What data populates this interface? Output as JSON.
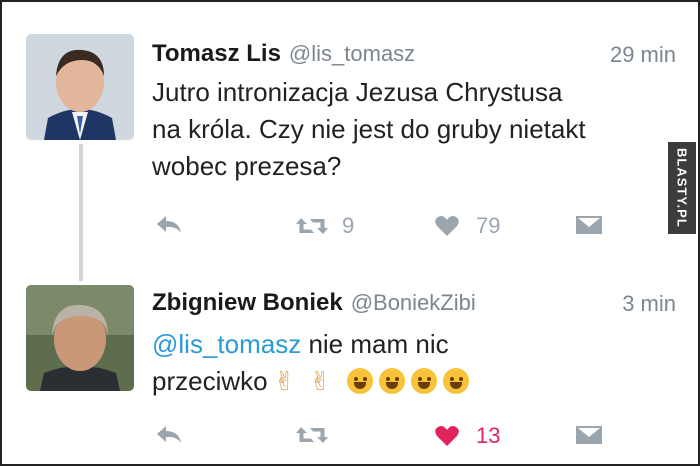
{
  "tweets": [
    {
      "author": "Tomasz Lis",
      "handle": "@lis_tomasz",
      "time": "29 min",
      "text_lines": [
        "Jutro intronizacja Jezusa Chrystusa",
        "na króla. Czy nie jest do gruby nietakt",
        "wobec prezesa?"
      ],
      "retweets": "9",
      "likes": "79",
      "avatar_icon": "man-portrait-suit"
    },
    {
      "author": "Zbigniew Boniek",
      "handle": "@BoniekZibi",
      "time": "3 min",
      "mention": "@lis_tomasz",
      "text_line1_rest": " nie mam nic",
      "text_line2": "przeciwko",
      "likes": "13",
      "avatar_icon": "man-portrait-gray-hair"
    }
  ],
  "watermark": "BLASTY.PL",
  "colors": {
    "mention": "#2a9ad8",
    "like_active": "#e0245e",
    "icon_gray": "#9aa5ae"
  }
}
